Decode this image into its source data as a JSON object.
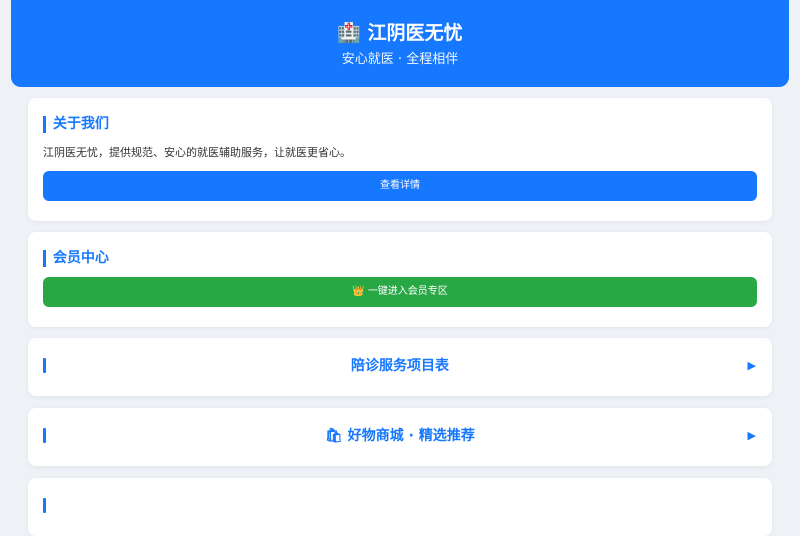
{
  "header": {
    "icon": "hospital-icon",
    "title": "江阴医无忧",
    "subtitle": "安心就医 · 全程相伴"
  },
  "about": {
    "title": "关于我们",
    "text": "江阴医无忧，提供规范、安心的就医辅助服务，让就医更省心。",
    "button_label": "查看详情"
  },
  "member": {
    "title": "会员中心",
    "button_icon": "crown-icon",
    "button_label": "一键进入会员专区"
  },
  "links": [
    {
      "label": "陪诊服务项目表"
    },
    {
      "icon": "shop-icon",
      "label": "好物商城 · 精选推荐"
    }
  ],
  "colors": {
    "accent": "#1677ff",
    "member_button": "#28a745",
    "background": "#eef2f7"
  }
}
